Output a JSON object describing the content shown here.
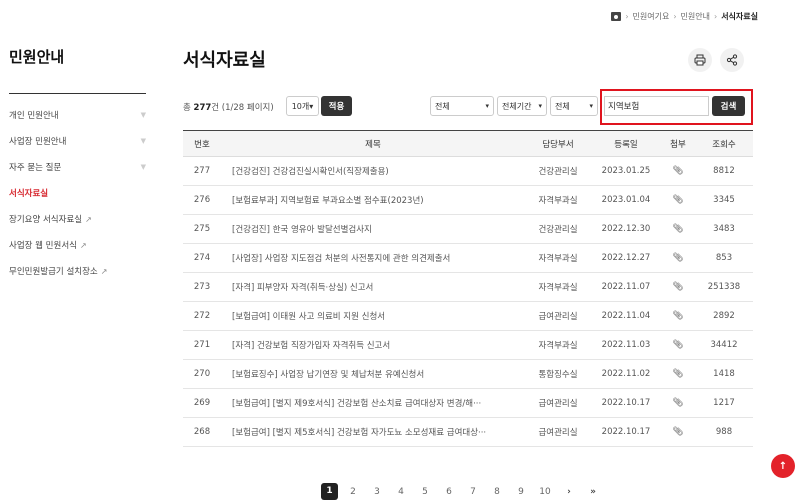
{
  "breadcrumb": {
    "items": [
      "민원여기요",
      "민원안내",
      "서식자료실"
    ]
  },
  "sidebar": {
    "title": "민원안내",
    "items": [
      {
        "label": "개인 민원안내",
        "chevron": true
      },
      {
        "label": "사업장 민원안내",
        "chevron": true
      },
      {
        "label": "자주 묻는 질문",
        "chevron": true
      },
      {
        "label": "서식자료실",
        "active": true
      },
      {
        "label": "장기요양 서식자료실",
        "external": true
      },
      {
        "label": "사업장 웹 민원서식",
        "external": true
      },
      {
        "label": "무인민원발급기 설치장소",
        "external": true
      }
    ]
  },
  "main": {
    "title": "서식자료실"
  },
  "toolbar": {
    "total_prefix": "총",
    "total_count": "277",
    "total_suffix": "건 (1/28 페이지)",
    "per_page": "10개",
    "apply_label": "적용",
    "filter1": "전체",
    "filter2": "전체기간",
    "filter3": "전체",
    "search_value": "지역보험",
    "search_label": "검색"
  },
  "table": {
    "headers": [
      "번호",
      "제목",
      "담당부서",
      "등록일",
      "첨부",
      "조회수"
    ],
    "rows": [
      {
        "no": "277",
        "title": "[건강검진] 건강검진실시확인서(직장제출용)",
        "dept": "건강관리실",
        "date": "2023.01.25",
        "views": "8812"
      },
      {
        "no": "276",
        "title": "[보험료부과] 지역보험료 부과요소별 점수표(2023년)",
        "dept": "자격부과실",
        "date": "2023.01.04",
        "views": "3345"
      },
      {
        "no": "275",
        "title": "[건강검진] 한국 영유아 발달선별검사지",
        "dept": "건강관리실",
        "date": "2022.12.30",
        "views": "3483"
      },
      {
        "no": "274",
        "title": "[사업장] 사업장 지도점검 처분의 사전통지에 관한 의견제출서",
        "dept": "자격부과실",
        "date": "2022.12.27",
        "views": "853"
      },
      {
        "no": "273",
        "title": "[자격] 피부양자 자격(취득·상실) 신고서",
        "dept": "자격부과실",
        "date": "2022.11.07",
        "views": "251338"
      },
      {
        "no": "272",
        "title": "[보험급여] 이태원 사고 의료비 지원 신청서",
        "dept": "급여관리실",
        "date": "2022.11.04",
        "views": "2892"
      },
      {
        "no": "271",
        "title": "[자격] 건강보험 직장가입자 자격취득 신고서",
        "dept": "자격부과실",
        "date": "2022.11.03",
        "views": "34412"
      },
      {
        "no": "270",
        "title": "[보험료징수] 사업장 납기연장 및 체납처분 유예신청서",
        "dept": "통합징수실",
        "date": "2022.11.02",
        "views": "1418"
      },
      {
        "no": "269",
        "title": "[보험급여] [별지 제9호서식] 건강보험 산소치료 급여대상자 변경/해···",
        "dept": "급여관리실",
        "date": "2022.10.17",
        "views": "1217"
      },
      {
        "no": "268",
        "title": "[보험급여] [별지 제5호서식] 건강보험 자가도뇨 소모성재료 급여대상···",
        "dept": "급여관리실",
        "date": "2022.10.17",
        "views": "988"
      }
    ]
  },
  "pagination": {
    "pages": [
      "1",
      "2",
      "3",
      "4",
      "5",
      "6",
      "7",
      "8",
      "9",
      "10"
    ],
    "current": "1",
    "next": "›",
    "last": "»"
  },
  "colors": {
    "accent": "#e0141e",
    "dark_button": "#333333",
    "active_menu": "#d7272f"
  },
  "icons": {
    "home": "home-icon",
    "print": "print-icon",
    "share": "share-icon",
    "attach": "paperclip-icon",
    "top": "arrow-up-icon",
    "external": "external-link-icon"
  }
}
